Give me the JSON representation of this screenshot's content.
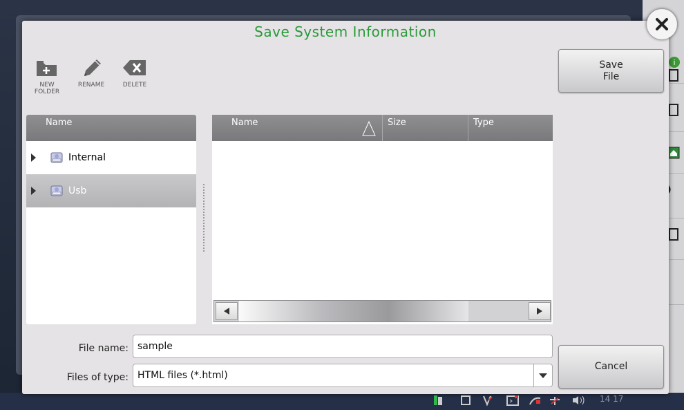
{
  "dialog": {
    "title": "Save System Information",
    "toolbar": {
      "new_folder_label_line1": "NEW",
      "new_folder_label_line2": "FOLDER",
      "rename_label": "RENAME",
      "delete_label": "DELETE"
    },
    "tree": {
      "header": "Name",
      "items": [
        {
          "label": "Internal",
          "selected": false
        },
        {
          "label": "Usb",
          "selected": true
        }
      ]
    },
    "file_list": {
      "columns": [
        "Name",
        "Size",
        "Type"
      ],
      "sort_column": "Name",
      "rows": []
    },
    "file_name": {
      "label": "File name:",
      "value": "sample"
    },
    "file_type": {
      "label": "Files of type:",
      "value": "HTML files (*.html)"
    },
    "save_button": {
      "line1": "Save",
      "line2": "File"
    },
    "cancel_button": "Cancel"
  },
  "status_bar": {
    "clock": "14 17"
  },
  "colors": {
    "title": "#2a9a3a",
    "header_bg": "#808083",
    "selected_bg": "#bcbcbf",
    "dialog_bg": "#e6e3e6"
  },
  "icons": [
    "close-icon",
    "new-folder-icon",
    "rename-pencil-icon",
    "delete-backspace-icon",
    "drive-icon",
    "sort-triangle-icon",
    "scroll-left-icon",
    "scroll-right-icon",
    "dropdown-arrow-icon",
    "info-icon",
    "home-icon",
    "speaker-icon"
  ]
}
